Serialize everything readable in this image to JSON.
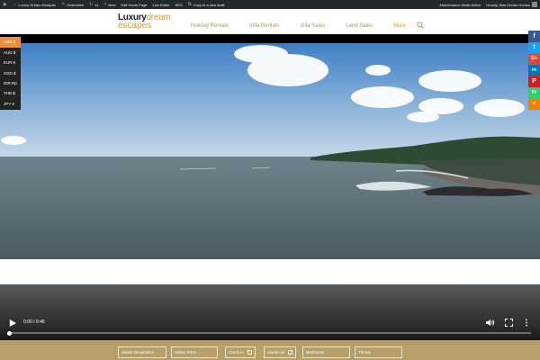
{
  "admin_bar": {
    "site_name": "Luxury Dream Escapes",
    "customize": "Customize",
    "updates": "11",
    "new": "New",
    "edit_home": "Edit Home Page",
    "live_editor": "Live Editor",
    "seo": "SEO",
    "copy_draft": "Copy to a new draft",
    "maintenance": "Maintenance Mode Active",
    "howdy": "Howdy, Asia Dream Homes"
  },
  "logo": {
    "word1": "Luxury",
    "word2": "dream",
    "word3": "escapes"
  },
  "nav": {
    "items": [
      "Holiday Rentals",
      "Villa Rentals",
      "Villa Sales",
      "Land Sales",
      "More"
    ]
  },
  "currencies": [
    "USD $",
    "AUD $",
    "EUR €",
    "SGD $",
    "IDR Rp",
    "THB ฿",
    "JPY ¥"
  ],
  "social": [
    "f",
    "t",
    "G+",
    "in",
    "P",
    "w",
    "<"
  ],
  "video": {
    "time": "0:00 / 0:46",
    "progress_fraction": 0.0
  },
  "booking": {
    "destination": "Select Destination",
    "price": "Select Price",
    "checkin": "check-in",
    "checkout": "check-out",
    "bedrooms": "Bedrooms",
    "theme": "Theme"
  },
  "colors": {
    "accent": "#e8913a",
    "gold": "#b5a06c",
    "admin": "#23282d"
  }
}
